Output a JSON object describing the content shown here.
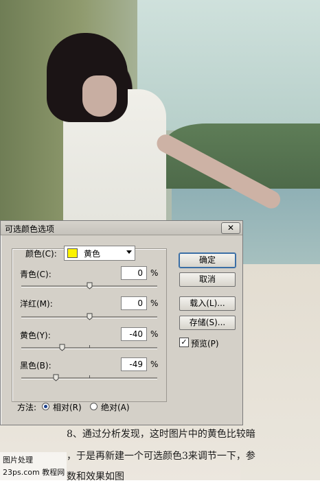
{
  "dialog": {
    "title": "可选颜色选项",
    "close_label": "✕",
    "colors_label": "颜色(C):",
    "colors_selected": "黄色",
    "colors_swatch": "#fcf300",
    "sliders": [
      {
        "label": "青色(C):",
        "value": "0",
        "unit": "%"
      },
      {
        "label": "洋红(M):",
        "value": "0",
        "unit": "%"
      },
      {
        "label": "黄色(Y):",
        "value": "-40",
        "unit": "%"
      },
      {
        "label": "黑色(B):",
        "value": "-49",
        "unit": "%"
      }
    ],
    "buttons": {
      "ok": "确定",
      "cancel": "取消",
      "load": "载入(L)...",
      "save": "存储(S)..."
    },
    "preview": {
      "label": "预览(P)",
      "checked": true
    },
    "method": {
      "label": "方法:",
      "options": [
        "相对(R)",
        "绝对(A)"
      ],
      "selected": "相对(R)"
    }
  },
  "caption": {
    "line1": "8、通过分析发现，这时图片中的黄色比较暗",
    "line2": "，于是再新建一个可选颜色3来调节一下，参",
    "line3": "数和效果如图"
  },
  "watermark": {
    "line1": "图片处理",
    "line2": "23ps.com  教程网"
  }
}
